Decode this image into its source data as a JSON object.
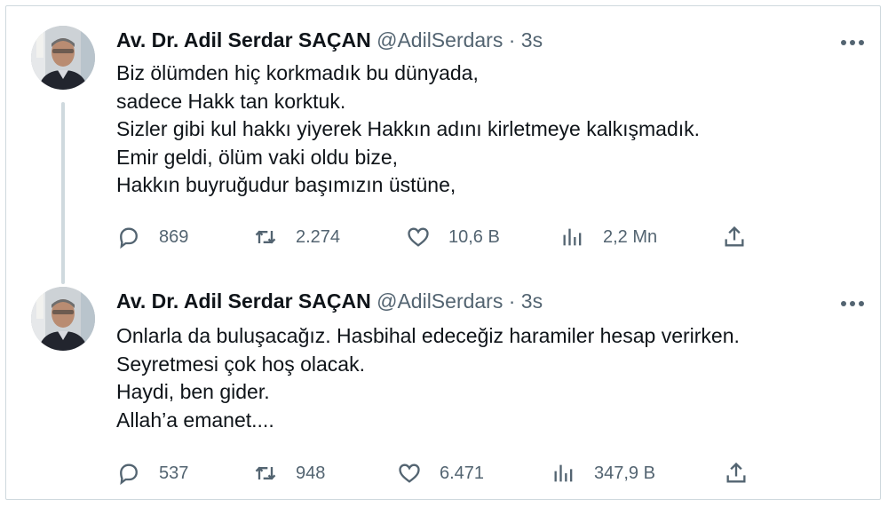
{
  "tweets": [
    {
      "author": {
        "name": "Av. Dr. Adil Serdar SAÇAN",
        "handle": "@AdilSerdars",
        "separator": "·",
        "time": "3s"
      },
      "lines": [
        "Biz ölümden hiç korkmadık bu dünyada,",
        "sadece Hakk tan korktuk.",
        "Sizler gibi kul hakkı yiyerek Hakkın adını kirletmeye kalkışmadık.",
        "Emir geldi, ölüm vaki oldu bize,",
        "Hakkın buyruğudur başımızın üstüne,"
      ],
      "actions": {
        "replies": "869",
        "retweets": "2.274",
        "likes": "10,6 B",
        "views": "2,2 Mn"
      }
    },
    {
      "author": {
        "name": "Av. Dr. Adil Serdar SAÇAN",
        "handle": "@AdilSerdars",
        "separator": "·",
        "time": "3s"
      },
      "lines": [
        "Onlarla da buluşacağız. Hasbihal edeceğiz haramiler hesap verirken.",
        "Seyretmesi çok hoş olacak.",
        "Haydi, ben gider.",
        "Allah’a emanet...."
      ],
      "actions": {
        "replies": "537",
        "retweets": "948",
        "likes": "6.471",
        "views": "347,9 B"
      }
    }
  ],
  "icons": {
    "reply": "reply-icon",
    "retweet": "retweet-icon",
    "like": "heart-icon",
    "views": "views-icon",
    "share": "share-icon",
    "more": "more-icon"
  },
  "colors": {
    "text": "#0f1419",
    "secondary": "#536471",
    "border": "#cfd9de"
  }
}
